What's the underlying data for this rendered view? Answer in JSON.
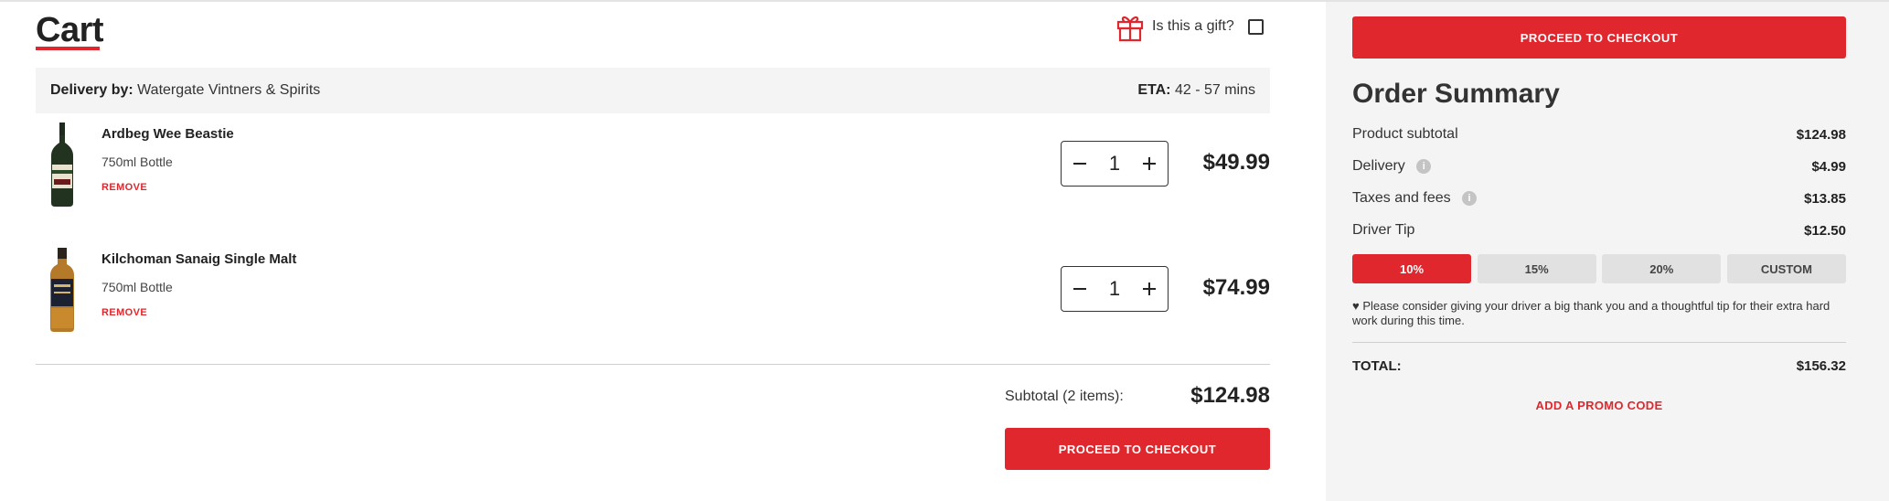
{
  "cart": {
    "title": "Cart",
    "gift_label": "Is this a gift?",
    "delivery_label": "Delivery by:",
    "delivery_store": "Watergate Vintners & Spirits",
    "eta_label": "ETA:",
    "eta_value": "42 - 57 mins",
    "items": [
      {
        "name": "Ardbeg Wee Beastie",
        "size": "750ml Bottle",
        "remove": "REMOVE",
        "qty": "1",
        "price": "$49.99"
      },
      {
        "name": "Kilchoman Sanaig Single Malt",
        "size": "750ml Bottle",
        "remove": "REMOVE",
        "qty": "1",
        "price": "$74.99"
      }
    ],
    "subtotal_label": "Subtotal (2 items):",
    "subtotal_value": "$124.98",
    "checkout_label": "PROCEED TO CHECKOUT"
  },
  "summary": {
    "checkout_label": "PROCEED TO CHECKOUT",
    "title": "Order Summary",
    "product_subtotal_label": "Product subtotal",
    "product_subtotal_value": "$124.98",
    "delivery_label": "Delivery",
    "delivery_value": "$4.99",
    "taxes_label": "Taxes and fees",
    "taxes_value": "$13.85",
    "tip_label": "Driver Tip",
    "tip_value": "$12.50",
    "tip_options": [
      "10%",
      "15%",
      "20%",
      "CUSTOM"
    ],
    "tip_selected": "10%",
    "tip_note": "Please consider giving your driver a big thank you and a thoughtful tip for their extra hard work during this time.",
    "total_label": "TOTAL:",
    "total_value": "$156.32",
    "promo_label": "ADD A PROMO CODE"
  },
  "colors": {
    "accent": "#e0272d",
    "panel_bg": "#f4f4f4",
    "text": "#222222"
  },
  "icons": [
    "gift-icon",
    "minus-icon",
    "plus-icon",
    "info-icon",
    "heart-icon",
    "bottle-image"
  ]
}
